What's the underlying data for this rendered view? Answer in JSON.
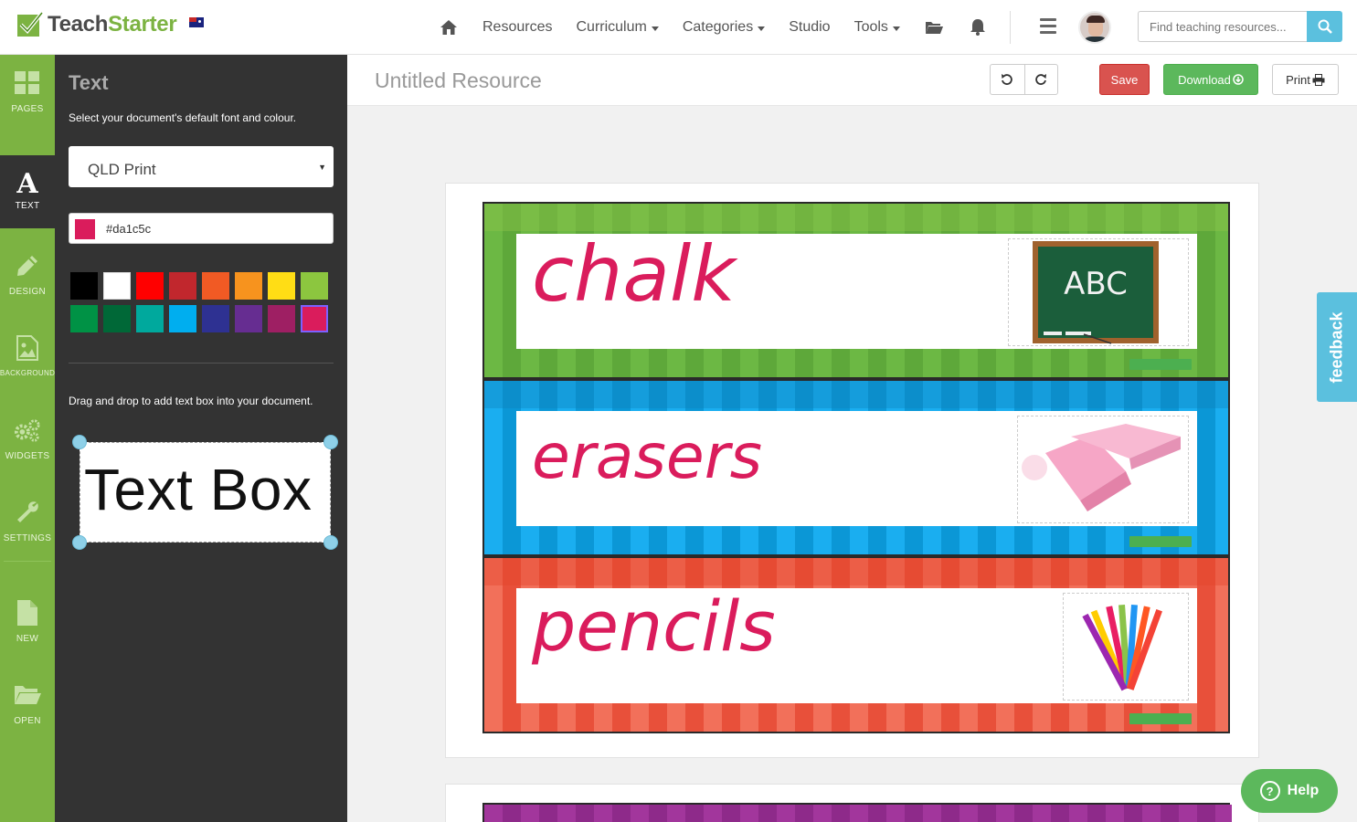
{
  "brand": {
    "teach": "Teach",
    "starter": "Starter"
  },
  "nav": {
    "items": [
      {
        "label": "Resources",
        "caret": false
      },
      {
        "label": "Curriculum",
        "caret": true
      },
      {
        "label": "Categories",
        "caret": true
      },
      {
        "label": "Studio",
        "caret": false
      },
      {
        "label": "Tools",
        "caret": true
      }
    ]
  },
  "search": {
    "placeholder": "Find teaching resources..."
  },
  "rail": {
    "items": [
      {
        "label": "PAGES"
      },
      {
        "label": "TEXT"
      },
      {
        "label": "DESIGN"
      },
      {
        "label": "BACKGROUND"
      },
      {
        "label": "WIDGETS"
      },
      {
        "label": "SETTINGS"
      },
      {
        "label": "NEW"
      },
      {
        "label": "OPEN"
      }
    ]
  },
  "panel": {
    "title": "Text",
    "description": "Select your document's default font and colour.",
    "font_value": "QLD Print",
    "color_value": "#da1c5c",
    "palette": [
      "#000000",
      "#ffffff",
      "#ff0000",
      "#c1272d",
      "#f15a24",
      "#f7931e",
      "#ffdd15",
      "#8cc63f",
      "#009245",
      "#006837",
      "#00a99d",
      "#00aeef",
      "#2e3192",
      "#662d91",
      "#9e1f63",
      "#da1c5c"
    ],
    "selected_color": "#da1c5c",
    "drag_description": "Drag and drop to add text box into your document.",
    "textbox_label": "Text Box"
  },
  "doc": {
    "title": "Untitled Resource",
    "save_label": "Save",
    "download_label": "Download",
    "print_label": "Print"
  },
  "cards": [
    {
      "word": "chalk",
      "theme": "green",
      "image": "chalkboard-image",
      "board_text": "ABC"
    },
    {
      "word": "erasers",
      "theme": "blue",
      "image": "erasers-image"
    },
    {
      "word": "pencils",
      "theme": "red",
      "image": "pencils-image"
    }
  ],
  "feedback_label": "feedback",
  "help_label": "Help",
  "colors": {
    "accent_green": "#7cb342",
    "save_red": "#d9534f",
    "download_green": "#5cb85c",
    "info_blue": "#5bc0de",
    "text_pink": "#da1c5c"
  }
}
